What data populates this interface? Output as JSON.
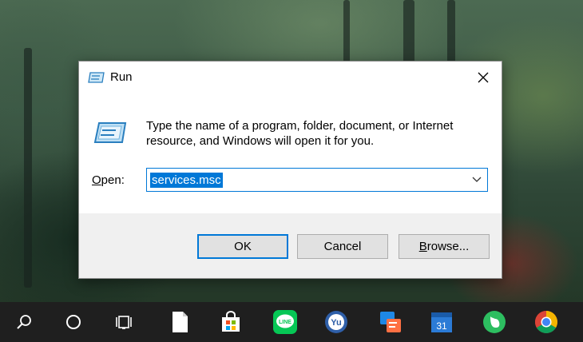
{
  "dialog": {
    "title": "Run",
    "description": "Type the name of a program, folder, document, or Internet resource, and Windows will open it for you.",
    "open_label_accel": "O",
    "open_label_rest": "pen:",
    "open_value": "services.msc",
    "ok_label": "OK",
    "cancel_label": "Cancel",
    "browse_accel": "B",
    "browse_rest": "rowse...",
    "icons": {
      "title": "run-icon",
      "close": "close-icon",
      "dropdown": "chevron-down-icon"
    }
  },
  "taskbar": {
    "items": [
      {
        "name": "search-icon"
      },
      {
        "name": "cortana-icon"
      },
      {
        "name": "task-view-icon"
      },
      {
        "name": "file-icon"
      },
      {
        "name": "microsoft-store-icon"
      },
      {
        "name": "line-app-icon",
        "label": "LINE"
      },
      {
        "name": "app-icon-globe",
        "label": "Yu"
      },
      {
        "name": "app-icon-translator"
      },
      {
        "name": "calendar-icon",
        "label": "31"
      },
      {
        "name": "evernote-icon"
      },
      {
        "name": "chrome-icon"
      }
    ]
  },
  "colors": {
    "accent": "#0078d7",
    "taskbar": "#1f1f1f",
    "footer": "#f0f0f0",
    "line_green": "#06c755",
    "evernote_green": "#2dbe60"
  }
}
